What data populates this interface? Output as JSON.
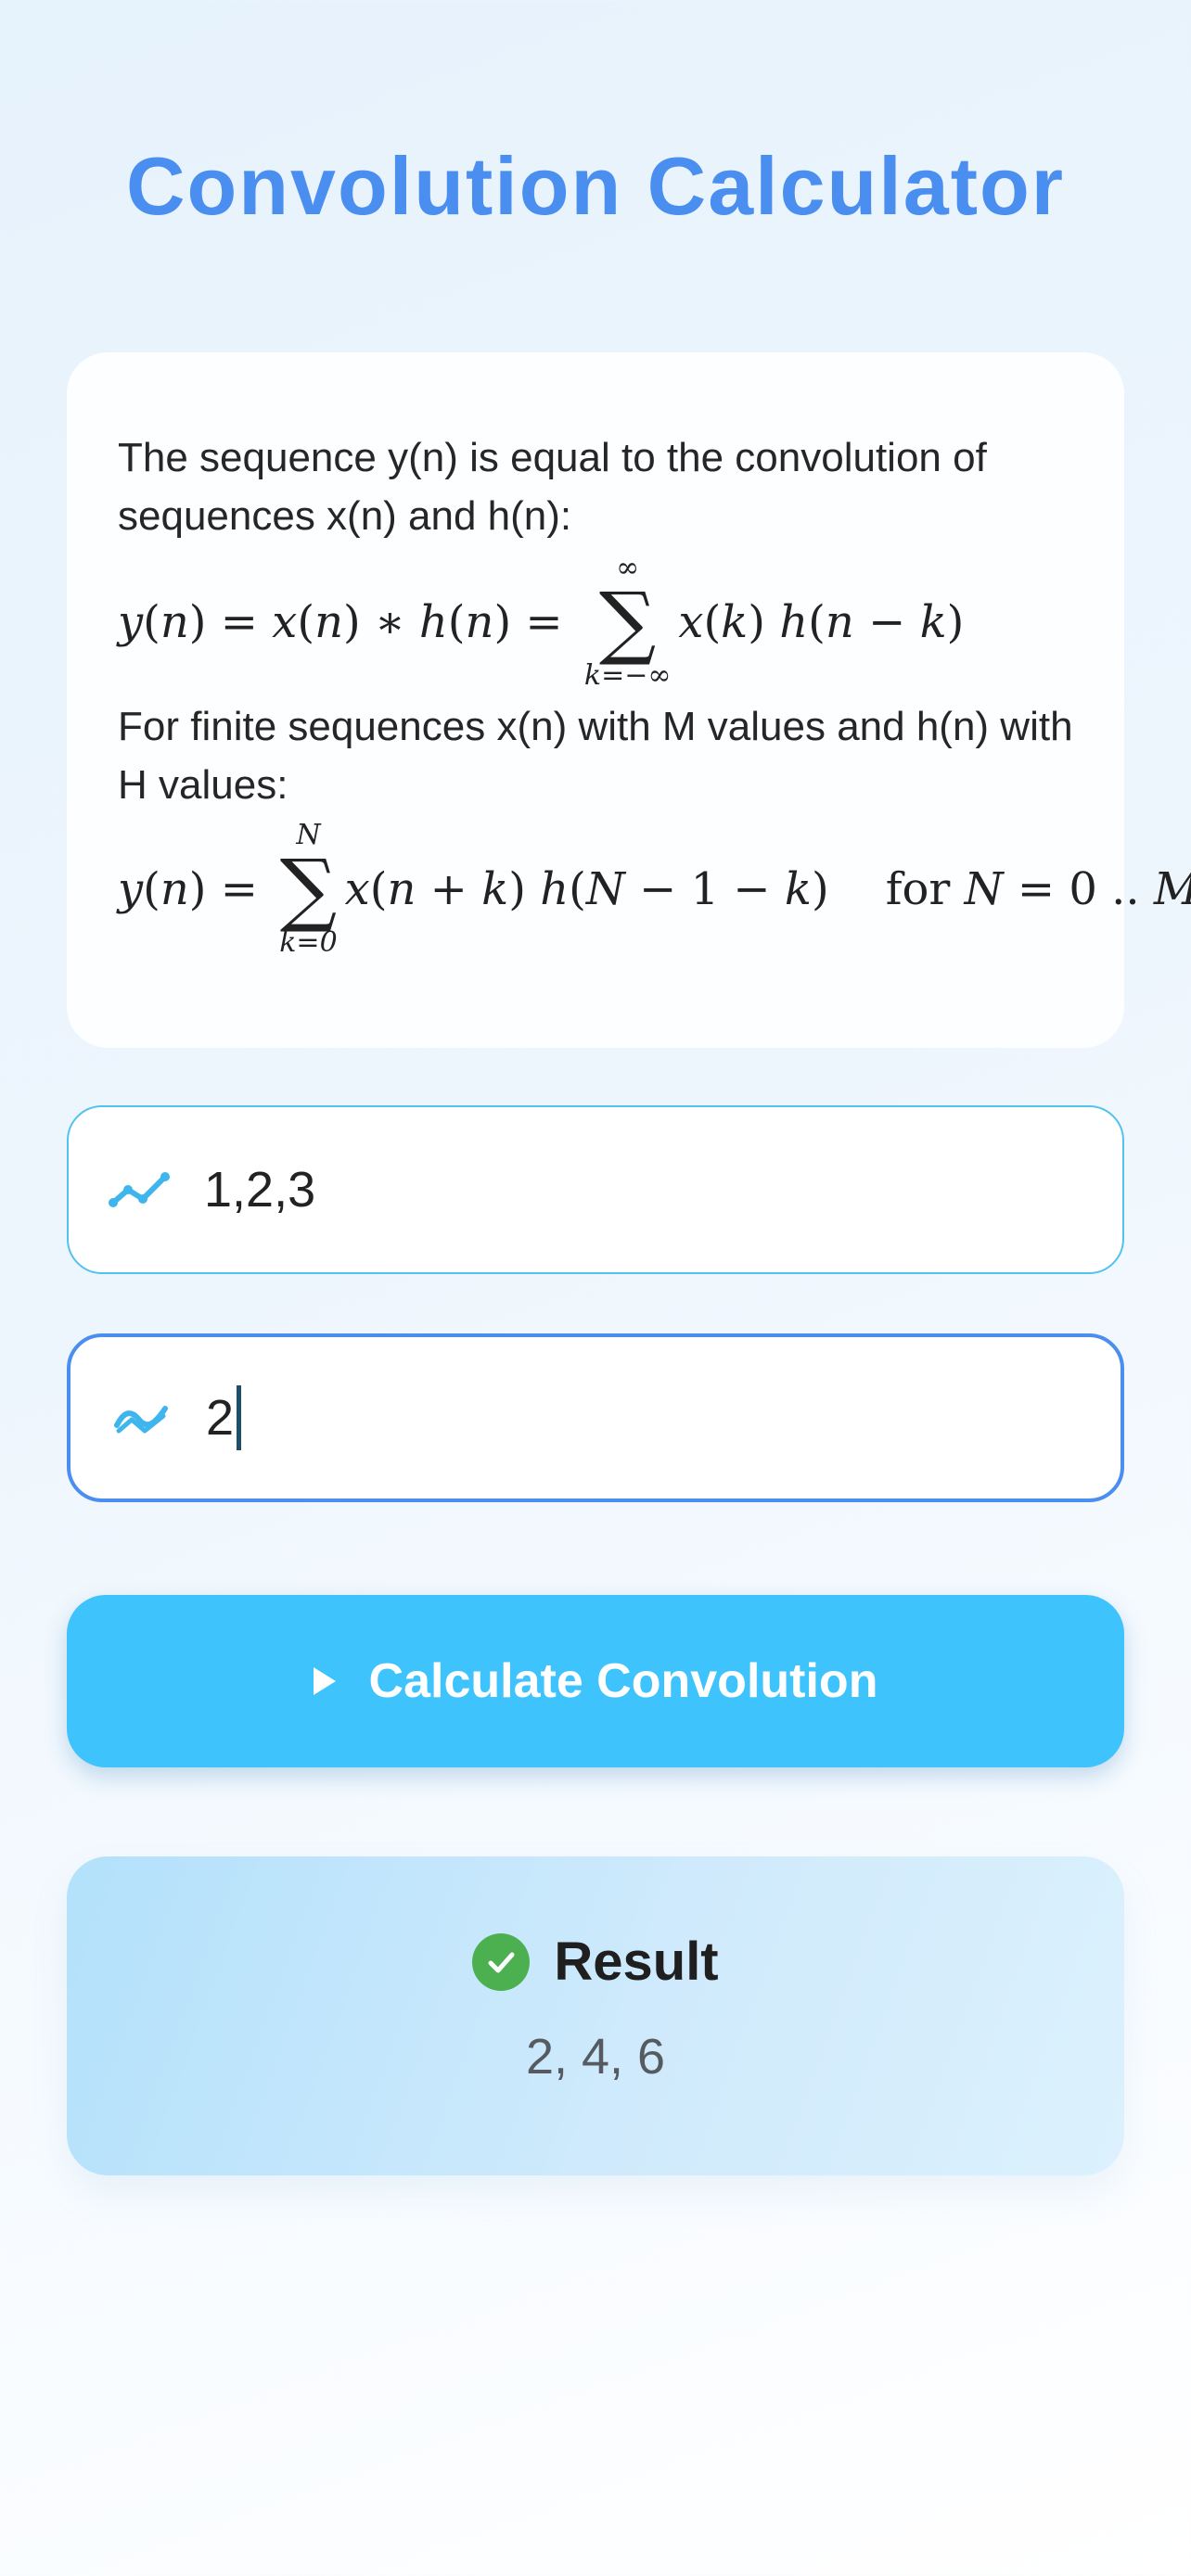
{
  "title": "Convolution Calculator",
  "info": {
    "intro": "The sequence y(n) is equal to the convolution of sequences x(n) and h(n):",
    "finite": "For finite sequences x(n) with M values and h(n) with H values:"
  },
  "inputs": {
    "x_value": "1,2,3",
    "h_value": "2",
    "x_icon": "line-chart-icon",
    "h_icon": "wave-chart-icon"
  },
  "button": {
    "label": "Calculate Convolution",
    "icon": "play-icon"
  },
  "result": {
    "label": "Result",
    "value": "2, 4, 6",
    "icon": "check-circle-icon"
  },
  "colors": {
    "accent": "#4a8ef0",
    "button": "#3fc3fc",
    "success": "#4caf50"
  }
}
